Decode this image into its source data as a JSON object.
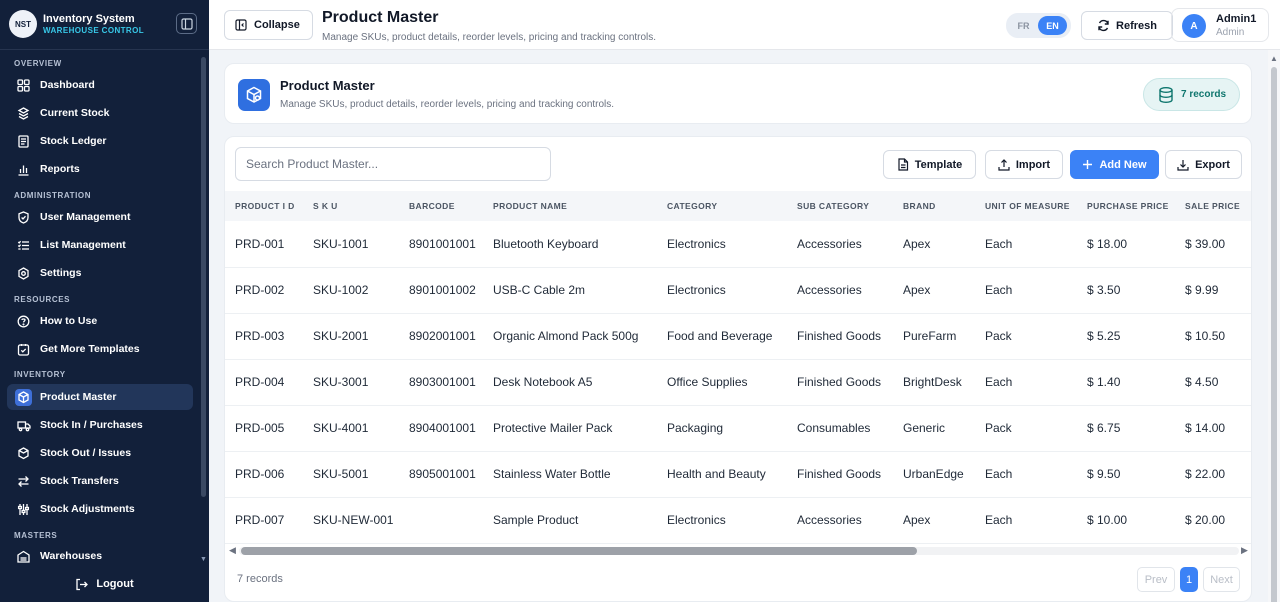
{
  "brand": {
    "logo_text": "NST",
    "title": "Inventory System",
    "subtitle": "WAREHOUSE CONTROL"
  },
  "sidebar": {
    "sections": [
      "OVERVIEW",
      "ADMINISTRATION",
      "RESOURCES",
      "INVENTORY",
      "MASTERS"
    ],
    "items": [
      {
        "label": "Dashboard",
        "icon": "dashboard-icon"
      },
      {
        "label": "Current Stock",
        "icon": "stock-icon"
      },
      {
        "label": "Stock Ledger",
        "icon": "ledger-icon"
      },
      {
        "label": "Reports",
        "icon": "reports-icon"
      },
      {
        "label": "User Management",
        "icon": "shield-icon"
      },
      {
        "label": "List Management",
        "icon": "list-icon"
      },
      {
        "label": "Settings",
        "icon": "settings-icon"
      },
      {
        "label": "How to Use",
        "icon": "help-icon"
      },
      {
        "label": "Get More Templates",
        "icon": "templates-icon"
      },
      {
        "label": "Product Master",
        "icon": "product-icon",
        "active": true
      },
      {
        "label": "Stock In / Purchases",
        "icon": "truck-icon"
      },
      {
        "label": "Stock Out / Issues",
        "icon": "box-out-icon"
      },
      {
        "label": "Stock Transfers",
        "icon": "transfer-icon"
      },
      {
        "label": "Stock Adjustments",
        "icon": "adjust-icon"
      },
      {
        "label": "Warehouses",
        "icon": "warehouse-icon"
      }
    ],
    "logout": "Logout"
  },
  "topbar": {
    "collapse": "Collapse",
    "title": "Product Master",
    "subtitle": "Manage SKUs, product details, reorder levels, pricing and tracking controls.",
    "lang": [
      "FR",
      "EN"
    ],
    "refresh": "Refresh",
    "user": {
      "initial": "A",
      "name": "Admin1",
      "role": "Admin"
    }
  },
  "header": {
    "title": "Product Master",
    "subtitle": "Manage SKUs, product details, reorder levels, pricing and tracking controls.",
    "records": "7 records"
  },
  "toolbar": {
    "search_placeholder": "Search Product Master...",
    "template": "Template",
    "import": "Import",
    "add_new": "Add New",
    "export": "Export"
  },
  "table": {
    "columns": [
      "PRODUCT I D",
      "S K U",
      "BARCODE",
      "PRODUCT NAME",
      "CATEGORY",
      "SUB CATEGORY",
      "BRAND",
      "UNIT OF MEASURE",
      "PURCHASE PRICE",
      "SALE PRICE"
    ],
    "rows": [
      [
        "PRD-001",
        "SKU-1001",
        "8901001001",
        "Bluetooth Keyboard",
        "Electronics",
        "Accessories",
        "Apex",
        "Each",
        "$ 18.00",
        "$ 39.00"
      ],
      [
        "PRD-002",
        "SKU-1002",
        "8901001002",
        "USB-C Cable 2m",
        "Electronics",
        "Accessories",
        "Apex",
        "Each",
        "$ 3.50",
        "$ 9.99"
      ],
      [
        "PRD-003",
        "SKU-2001",
        "8902001001",
        "Organic Almond Pack 500g",
        "Food and Beverage",
        "Finished Goods",
        "PureFarm",
        "Pack",
        "$ 5.25",
        "$ 10.50"
      ],
      [
        "PRD-004",
        "SKU-3001",
        "8903001001",
        "Desk Notebook A5",
        "Office Supplies",
        "Finished Goods",
        "BrightDesk",
        "Each",
        "$ 1.40",
        "$ 4.50"
      ],
      [
        "PRD-005",
        "SKU-4001",
        "8904001001",
        "Protective Mailer Pack",
        "Packaging",
        "Consumables",
        "Generic",
        "Pack",
        "$ 6.75",
        "$ 14.00"
      ],
      [
        "PRD-006",
        "SKU-5001",
        "8905001001",
        "Stainless Water Bottle",
        "Health and Beauty",
        "Finished Goods",
        "UrbanEdge",
        "Each",
        "$ 9.50",
        "$ 22.00"
      ],
      [
        "PRD-007",
        "SKU-NEW-001",
        "",
        "Sample Product",
        "Electronics",
        "Accessories",
        "Apex",
        "Each",
        "$ 10.00",
        "$ 20.00"
      ]
    ]
  },
  "footer": {
    "count": "7 records",
    "prev": "Prev",
    "page": "1",
    "next": "Next"
  },
  "colors": {
    "sidebar_bg": "#12203a",
    "accent": "#3b82f6",
    "brand_sub": "#38c8e8"
  }
}
